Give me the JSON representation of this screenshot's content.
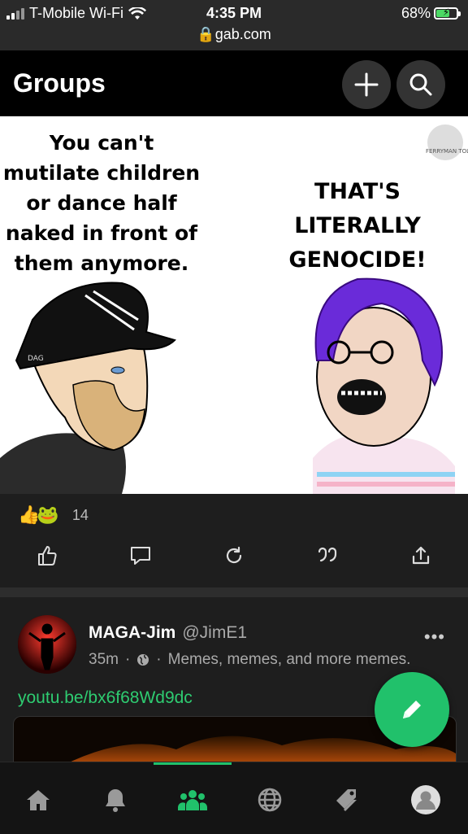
{
  "status_bar": {
    "carrier": "T-Mobile Wi-Fi",
    "time": "4:35 PM",
    "url": "gab.com",
    "battery": "68%",
    "battery_level": 0.68
  },
  "header": {
    "title": "Groups",
    "add_icon": "plus-icon",
    "search_icon": "search-icon"
  },
  "meme": {
    "left_text": "You can't mutilate children or dance half naked in front of them anymore.",
    "right_text": "THAT'S LITERALLY GENOCIDE!",
    "cap_badge": "DAG",
    "watermark": "FERRYMAN TOLLS"
  },
  "reactions": {
    "count": "14",
    "icons": [
      "thumbs-up-emoji",
      "frog-emoji"
    ]
  },
  "actions": [
    "like-icon",
    "comment-icon",
    "repost-icon",
    "quote-icon",
    "share-icon"
  ],
  "post": {
    "author_name": "MAGA-Jim",
    "author_handle": "@JimE1",
    "time": "35m",
    "separator": "·",
    "group": "Memes, memes, and more memes.",
    "more": "•••",
    "link": "youtu.be/bx6f68Wd9dc"
  },
  "bottom_nav": [
    "home-icon",
    "bell-icon",
    "groups-icon",
    "globe-icon",
    "tag-icon",
    "profile-icon"
  ],
  "colors": {
    "accent": "#21c16b",
    "link": "#2ecc71",
    "background": "#1e1e1e",
    "header": "#000000"
  }
}
